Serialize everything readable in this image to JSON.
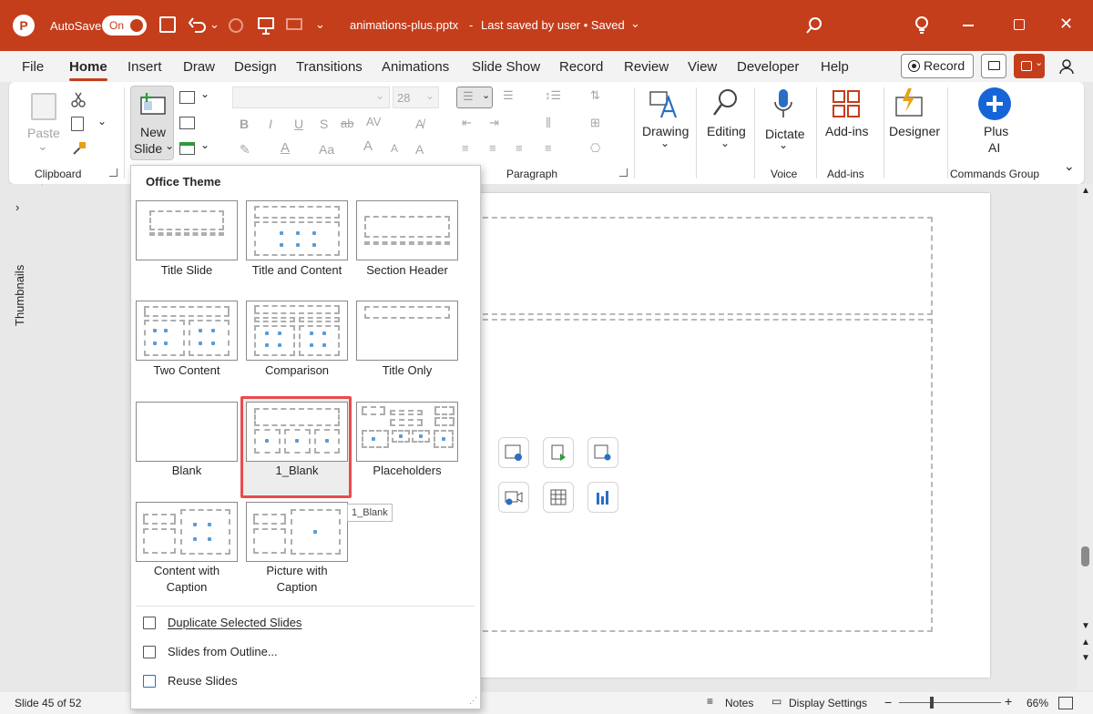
{
  "titlebar": {
    "autosave": "AutoSave",
    "toggle": "On",
    "filename": "animations-plus.pptx",
    "status": "Last saved by user • Saved",
    "bg": "#c43e1c"
  },
  "menu": [
    "File",
    "Home",
    "Insert",
    "Draw",
    "Design",
    "Transitions",
    "Animations",
    "Slide Show",
    "Record",
    "Review",
    "View",
    "Developer",
    "Help"
  ],
  "menu_active": "Home",
  "record_button": "Record",
  "ribbon": {
    "paste": "Paste",
    "clipboard": "Clipboard",
    "new_slide_1": "New",
    "new_slide_2": "Slide",
    "font_size": "28",
    "paragraph": "Paragraph",
    "drawing": "Drawing",
    "editing": "Editing",
    "dictate": "Dictate",
    "voice": "Voice",
    "addins": "Add-ins",
    "addins_group": "Add-ins",
    "designer": "Designer",
    "plus_1": "Plus",
    "plus_2": "AI",
    "commands_group": "Commands Group",
    "bold": "B",
    "italic": "I",
    "underline": "U",
    "strike": "S",
    "spacing": "AV",
    "font_color_a": "A",
    "font_size_aa": "Aa"
  },
  "thumbnails": "Thumbnails",
  "dropdown": {
    "title": "Office Theme",
    "layouts": [
      "Title Slide",
      "Title and Content",
      "Section Header",
      "Two Content",
      "Comparison",
      "Title Only",
      "Blank",
      "1_Blank",
      "Placeholders",
      "Content with\nCaption",
      "Picture with\nCaption"
    ],
    "selected": "1_Blank",
    "tooltip": "1_Blank",
    "commands": [
      "Duplicate Selected Slides",
      "Slides from Outline...",
      "Reuse Slides"
    ]
  },
  "status": {
    "slide": "Slide 45 of 52",
    "notes": "Notes",
    "display": "Display Settings",
    "minus": "−",
    "plus": "+",
    "zoom": "66%"
  },
  "colors": {
    "accent": "#c43e1c",
    "highlight": "#e84c4c",
    "placeholder_icon": "#5b9bd5"
  }
}
